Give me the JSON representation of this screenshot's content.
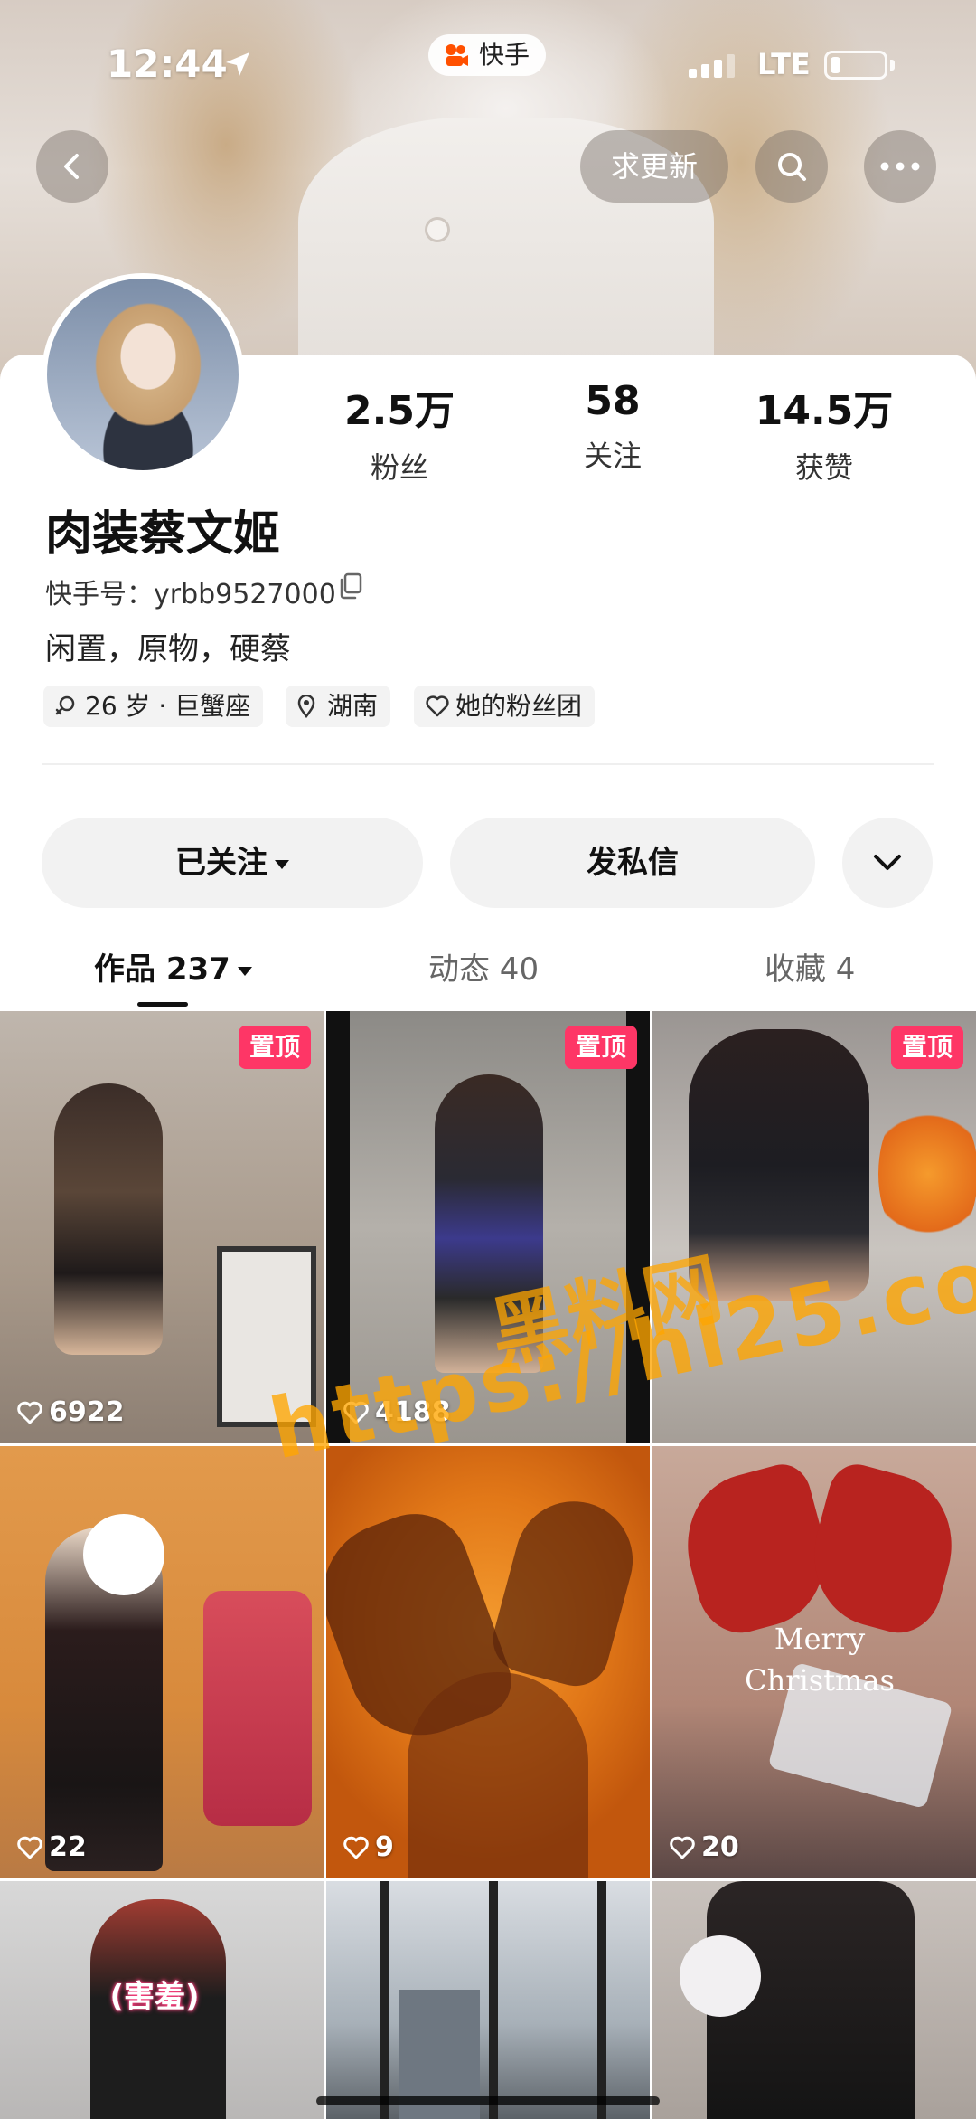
{
  "status_bar": {
    "time": "12:44",
    "network": "LTE",
    "app_name": "快手",
    "battery_percent": 20
  },
  "nav": {
    "refresh_label": "求更新"
  },
  "profile": {
    "stats": [
      {
        "value": "2.5万",
        "label": "粉丝"
      },
      {
        "value": "58",
        "label": "关注"
      },
      {
        "value": "14.5万",
        "label": "获赞"
      }
    ],
    "name": "肉装蔡文姬",
    "kwai_id": "快手号：yrbb9527000",
    "bio": "闲置，原物，硬蔡",
    "tags": [
      "26 岁 · 巨蟹座",
      "湖南",
      "她的粉丝团"
    ]
  },
  "actions": {
    "follow_label": "已关注",
    "message_label": "发私信"
  },
  "tabs": [
    {
      "label": "作品 237",
      "active": true
    },
    {
      "label": "动态 40",
      "active": false
    },
    {
      "label": "收藏 4",
      "active": false
    }
  ],
  "grid": {
    "pinned_label": "置顶",
    "items": [
      {
        "likes": "6922",
        "pinned": true
      },
      {
        "likes": "4188",
        "pinned": true
      },
      {
        "likes": "",
        "pinned": true
      },
      {
        "likes": "22",
        "pinned": false
      },
      {
        "likes": "9",
        "pinned": false
      },
      {
        "likes": "20",
        "pinned": false,
        "overlay_text": "Merry Christmas"
      },
      {
        "likes": "",
        "pinned": false,
        "overlay_text": "(害羞)"
      },
      {
        "likes": "",
        "pinned": false
      },
      {
        "likes": "",
        "pinned": false
      }
    ]
  },
  "watermark": {
    "title": "黑料网",
    "url": "https://hl25.co"
  },
  "colors": {
    "pin_badge": "#fe3666",
    "watermark": "#ffa500"
  }
}
